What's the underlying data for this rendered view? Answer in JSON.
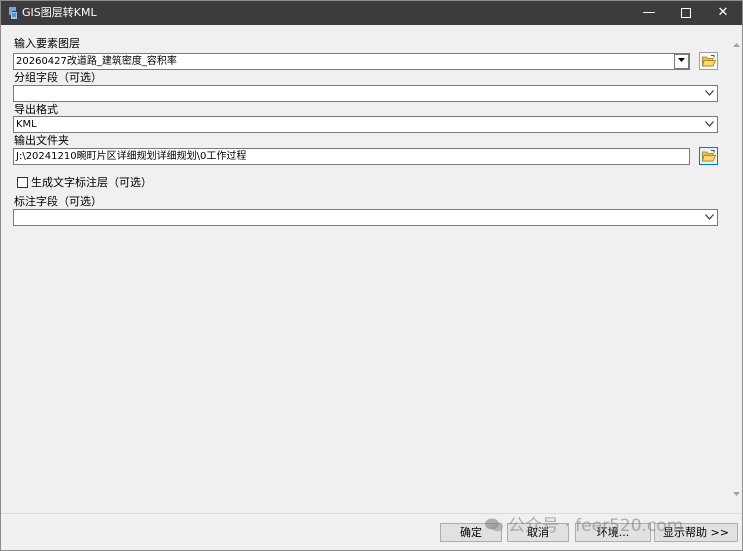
{
  "window": {
    "title": "GIS图层转KML",
    "min_glyph": "—",
    "close_glyph": "✕"
  },
  "form": {
    "input_layer": {
      "label": "输入要素图层",
      "value": "20260427改道路_建筑密度_容积率"
    },
    "group_field": {
      "label": "分组字段（可选）",
      "value": ""
    },
    "export_format": {
      "label": "导出格式",
      "value": "KML"
    },
    "output_folder": {
      "label": "输出文件夹",
      "value": "J:\\20241210畹町片区详细规划详细规划\\0工作过程"
    },
    "generate_labels": {
      "label": "生成文字标注层（可选）",
      "checked": false
    },
    "label_field": {
      "label": "标注字段（可选）",
      "value": ""
    }
  },
  "footer": {
    "ok": "确定",
    "cancel": "取消",
    "environment": "环境...",
    "show_help": "显示帮助 >>"
  },
  "watermark": {
    "text": "公众号 · feer520.com"
  },
  "icons": {
    "app": "toolbox-icon",
    "folder": "open-folder-icon",
    "dropdown": "chevron-down-icon"
  },
  "colors": {
    "titlebar": "#3c3c3c",
    "accent": "#0078d7",
    "folder": "#e8b53a"
  }
}
